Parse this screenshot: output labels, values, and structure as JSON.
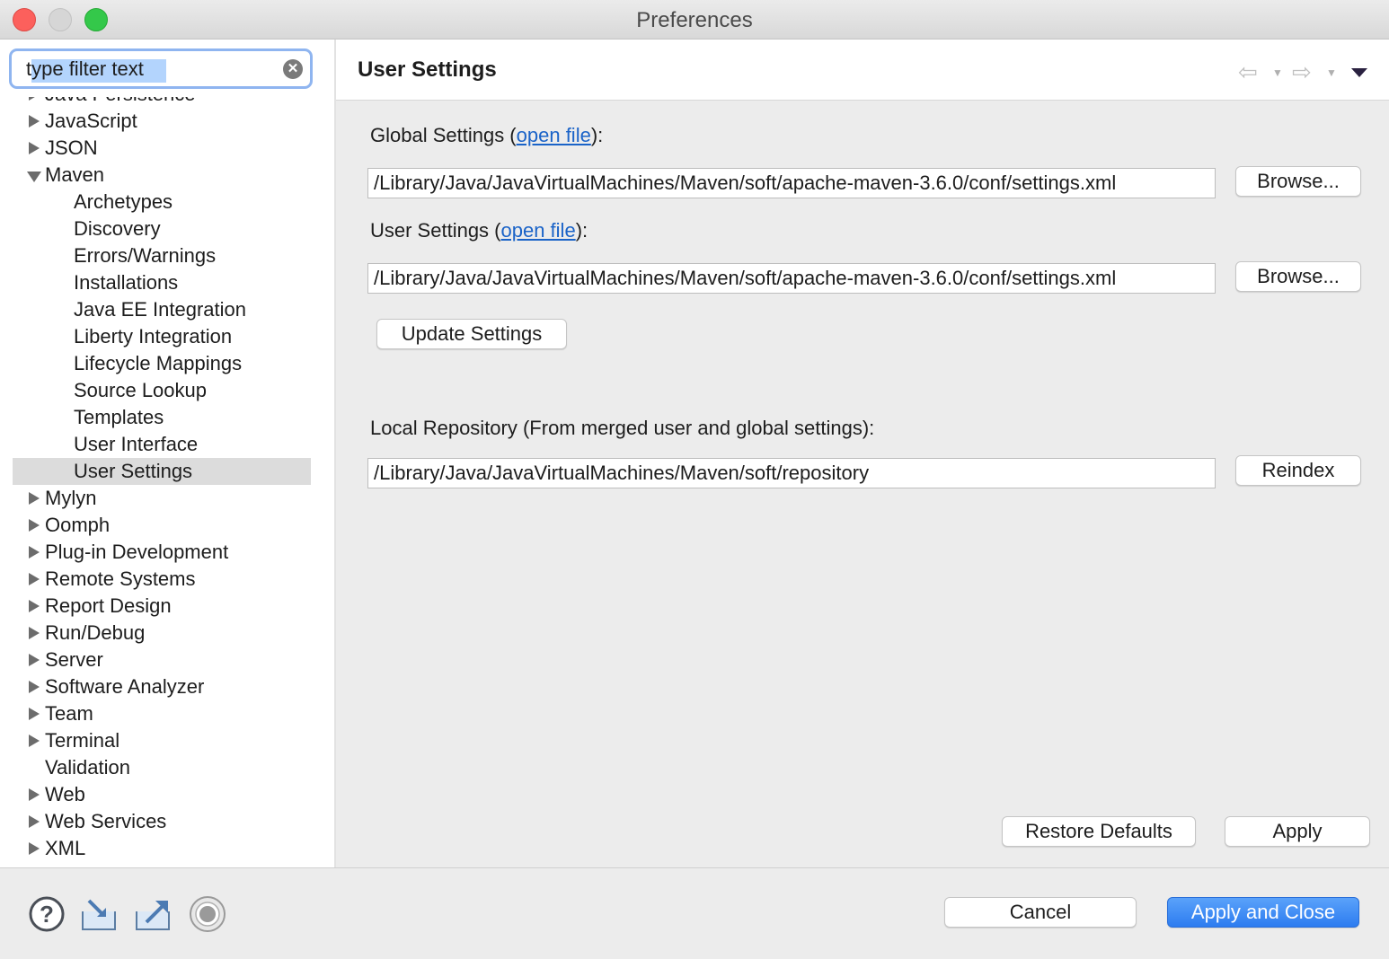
{
  "window": {
    "title": "Preferences"
  },
  "filter": {
    "placeholder": "type filter text",
    "value": "type filter text"
  },
  "tree": [
    {
      "label": "Java Persistence",
      "level": 0,
      "expander": "closed"
    },
    {
      "label": "JavaScript",
      "level": 0,
      "expander": "closed"
    },
    {
      "label": "JSON",
      "level": 0,
      "expander": "closed"
    },
    {
      "label": "Maven",
      "level": 0,
      "expander": "open"
    },
    {
      "label": "Archetypes",
      "level": 1,
      "expander": "none"
    },
    {
      "label": "Discovery",
      "level": 1,
      "expander": "none"
    },
    {
      "label": "Errors/Warnings",
      "level": 1,
      "expander": "none"
    },
    {
      "label": "Installations",
      "level": 1,
      "expander": "none"
    },
    {
      "label": "Java EE Integration",
      "level": 1,
      "expander": "none"
    },
    {
      "label": "Liberty Integration",
      "level": 1,
      "expander": "none"
    },
    {
      "label": "Lifecycle Mappings",
      "level": 1,
      "expander": "none"
    },
    {
      "label": "Source Lookup",
      "level": 1,
      "expander": "none"
    },
    {
      "label": "Templates",
      "level": 1,
      "expander": "none"
    },
    {
      "label": "User Interface",
      "level": 1,
      "expander": "none"
    },
    {
      "label": "User Settings",
      "level": 1,
      "expander": "none",
      "selected": true
    },
    {
      "label": "Mylyn",
      "level": 0,
      "expander": "closed"
    },
    {
      "label": "Oomph",
      "level": 0,
      "expander": "closed"
    },
    {
      "label": "Plug-in Development",
      "level": 0,
      "expander": "closed"
    },
    {
      "label": "Remote Systems",
      "level": 0,
      "expander": "closed"
    },
    {
      "label": "Report Design",
      "level": 0,
      "expander": "closed"
    },
    {
      "label": "Run/Debug",
      "level": 0,
      "expander": "closed"
    },
    {
      "label": "Server",
      "level": 0,
      "expander": "closed"
    },
    {
      "label": "Software Analyzer",
      "level": 0,
      "expander": "closed"
    },
    {
      "label": "Team",
      "level": 0,
      "expander": "closed"
    },
    {
      "label": "Terminal",
      "level": 0,
      "expander": "closed"
    },
    {
      "label": "Validation",
      "level": 0,
      "expander": "none"
    },
    {
      "label": "Web",
      "level": 0,
      "expander": "closed"
    },
    {
      "label": "Web Services",
      "level": 0,
      "expander": "closed"
    },
    {
      "label": "XML",
      "level": 0,
      "expander": "closed"
    }
  ],
  "page": {
    "title": "User Settings",
    "icons": {
      "back": "back-arrow-icon",
      "forward": "forward-arrow-icon",
      "menu": "view-menu-icon"
    },
    "global": {
      "label": "Global Settings (",
      "link": "open file",
      "suffix": "):",
      "path": "/Library/Java/JavaVirtualMachines/Maven/soft/apache-maven-3.6.0/conf/settings.xml",
      "browse": "Browse..."
    },
    "user": {
      "label": "User Settings (",
      "link": "open file",
      "suffix": "):",
      "path": "/Library/Java/JavaVirtualMachines/Maven/soft/apache-maven-3.6.0/conf/settings.xml",
      "browse": "Browse..."
    },
    "update_button": "Update Settings",
    "local_repo": {
      "label": "Local Repository (From merged user and global settings):",
      "path": "/Library/Java/JavaVirtualMachines/Maven/soft/repository",
      "reindex": "Reindex"
    },
    "restore_defaults": "Restore Defaults",
    "apply": "Apply"
  },
  "footer": {
    "icons": [
      "help-icon",
      "import-icon",
      "export-icon",
      "record-icon"
    ],
    "cancel": "Cancel",
    "apply_close": "Apply and Close"
  },
  "colors": {
    "accent": "#2d7cf0",
    "link": "#1a63c8",
    "selection": "#dcdcdc"
  }
}
